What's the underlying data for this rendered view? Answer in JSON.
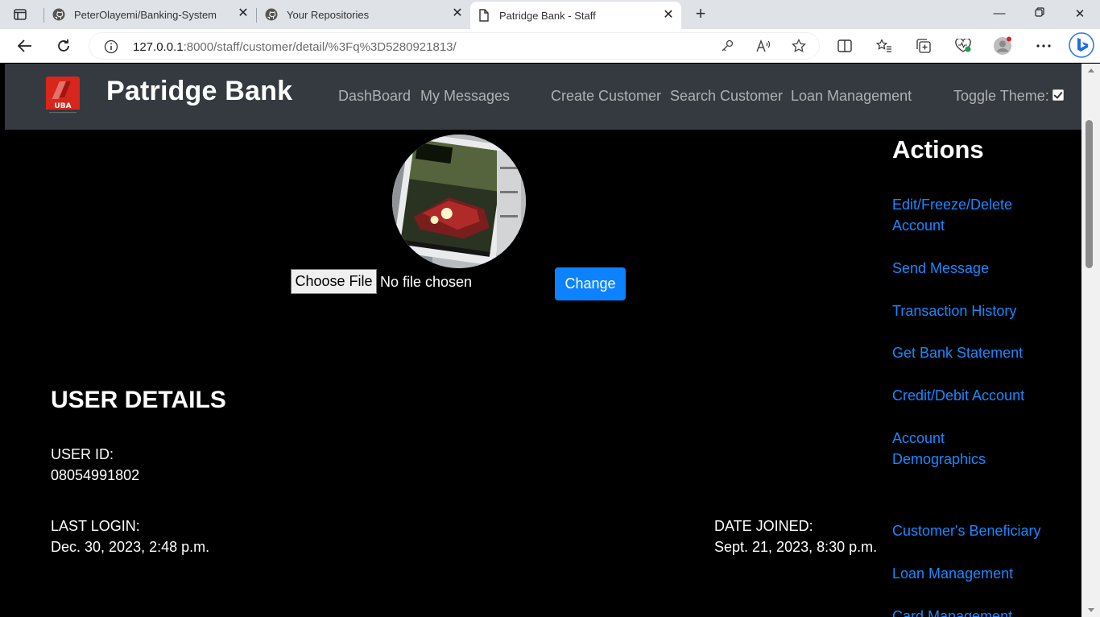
{
  "browser": {
    "tabs": [
      {
        "title": "PeterOlayemi/Banking-System",
        "icon": "github-icon"
      },
      {
        "title": "Your Repositories",
        "icon": "github-icon"
      },
      {
        "title": "Patridge Bank - Staff",
        "icon": "page-icon"
      }
    ],
    "url_host": "127.0.0.1",
    "url_path": ":8000/staff/customer/detail/%3Fq%3D5280921813/"
  },
  "navbar": {
    "brand": "Patridge Bank",
    "logo_text": "UBA",
    "links": [
      "DashBoard",
      "My Messages",
      "Create Customer",
      "Search Customer",
      "Loan Management"
    ],
    "toggle_label": "Toggle Theme:",
    "toggle_checked": true
  },
  "profile": {
    "choose_file_label": "Choose File",
    "file_status": "No file chosen",
    "change_label": "Change"
  },
  "user_details": {
    "heading": "USER DETAILS",
    "user_id_label": "USER ID:",
    "user_id": "08054991802",
    "last_login_label": "LAST LOGIN:",
    "last_login": "Dec. 30, 2023, 2:48 p.m.",
    "date_joined_label": "DATE JOINED:",
    "date_joined": "Sept. 21, 2023, 8:30 p.m."
  },
  "actions": {
    "heading": "Actions",
    "links": [
      "Edit/Freeze/Delete Account",
      "Send Message",
      "Transaction History",
      "Get Bank Statement",
      "Credit/Debit Account",
      "Account Demographics",
      "Customer's Beneficiary",
      "Loan Management",
      "Card Management"
    ]
  },
  "colors": {
    "navbar_bg": "#343a40",
    "page_bg": "#000000",
    "link_blue": "#1a88ff",
    "button_blue": "#0d82ff"
  }
}
